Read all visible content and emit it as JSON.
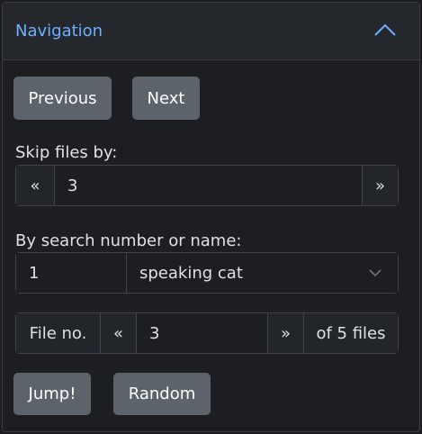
{
  "header": {
    "title": "Navigation",
    "collapse_icon": "chevron-up-icon"
  },
  "nav": {
    "previous_label": "Previous",
    "next_label": "Next"
  },
  "skip": {
    "label": "Skip files by:",
    "dec_label": "«",
    "value": "3",
    "inc_label": "»"
  },
  "search": {
    "label": "By search number or name:",
    "number_value": "1",
    "name_value": "speaking cat",
    "dropdown_icon": "chevron-down-icon"
  },
  "file": {
    "prefix_label": "File no.",
    "dec_label": "«",
    "value": "3",
    "inc_label": "»",
    "suffix_label": "of 5 files"
  },
  "actions": {
    "jump_label": "Jump!",
    "random_label": "Random"
  },
  "colors": {
    "accent": "#6fb0ff",
    "button_bg": "#5c636b",
    "panel_bg": "#1c1e21",
    "header_bg": "#24272b",
    "border": "#41454b",
    "text": "#dee2e6"
  }
}
